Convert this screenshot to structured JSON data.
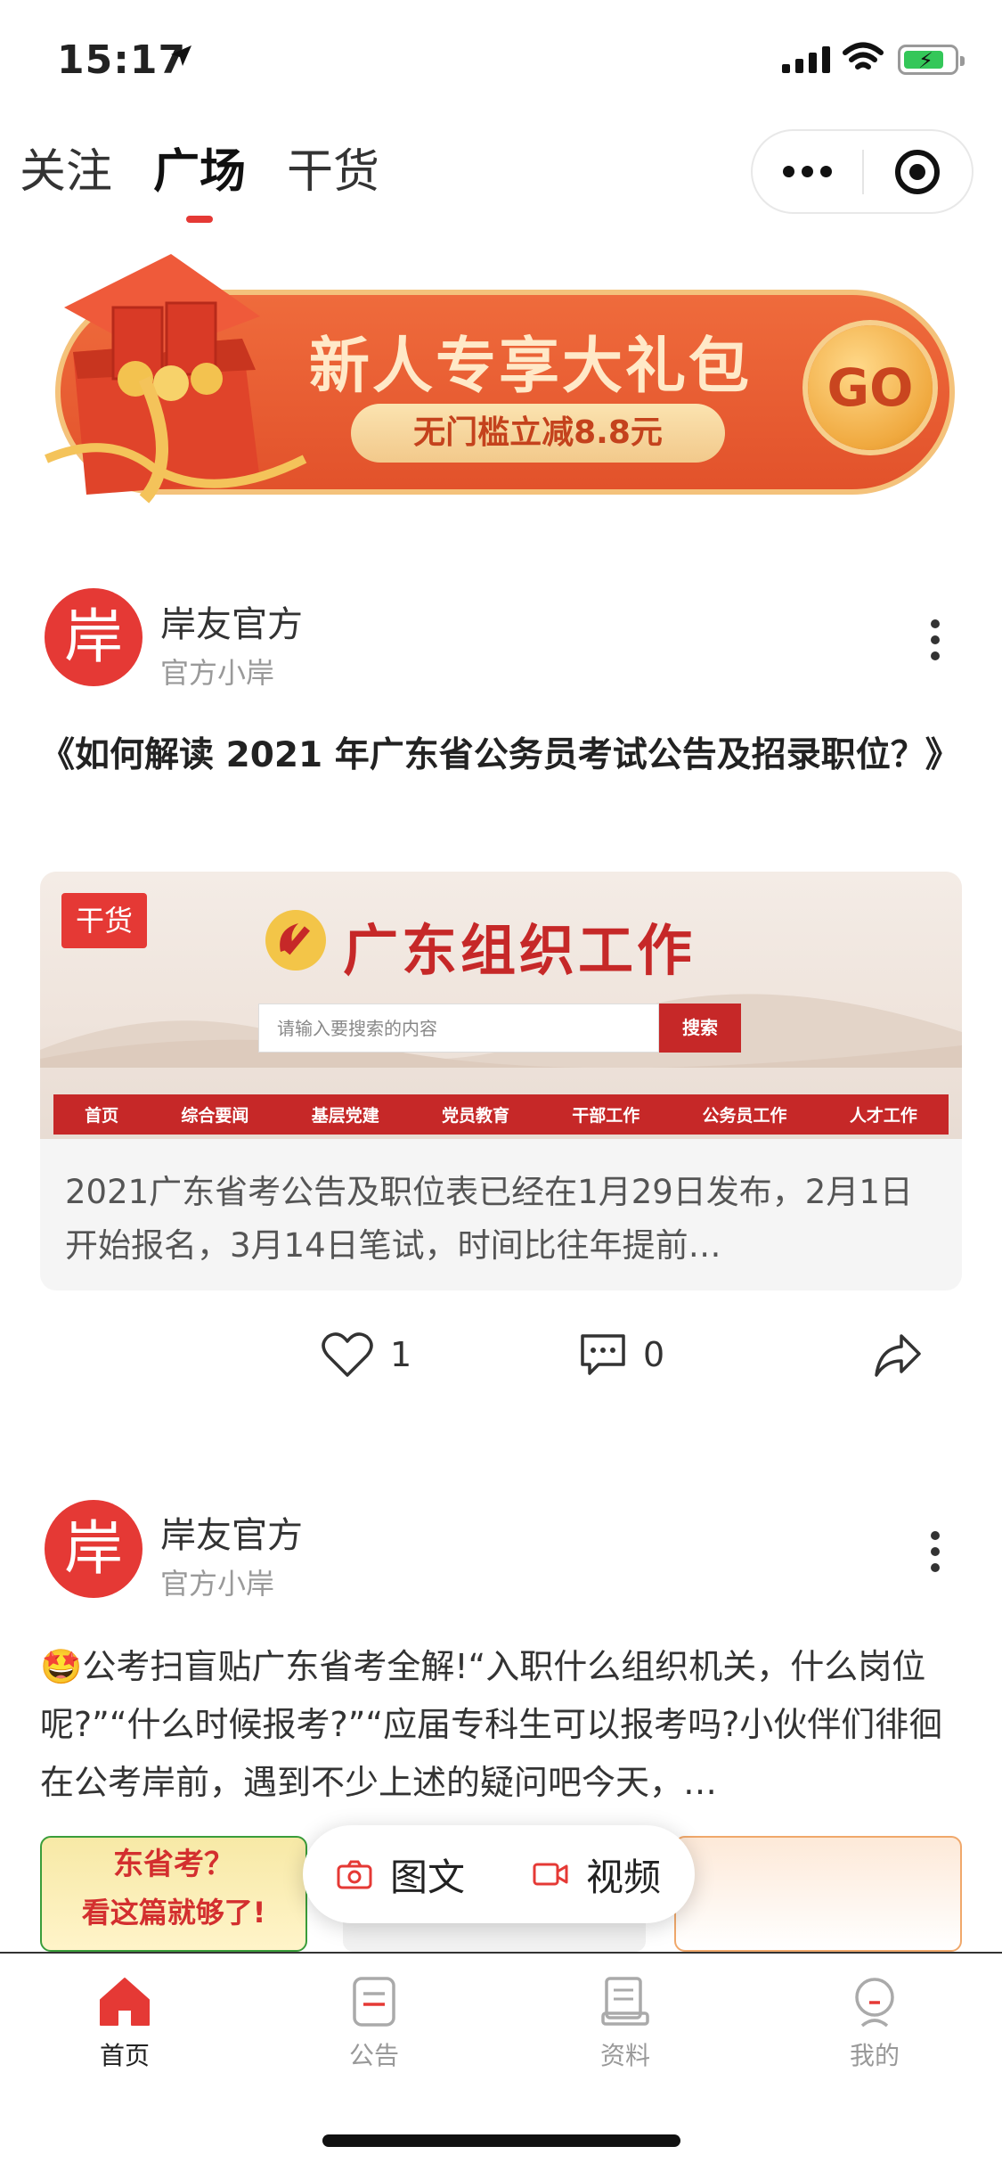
{
  "status_bar": {
    "time": "15:17"
  },
  "top_tabs": [
    {
      "label": "关注"
    },
    {
      "label": "广场",
      "active": true
    },
    {
      "label": "干货"
    }
  ],
  "banner": {
    "title": "新人专享大礼包",
    "subtitle": "无门槛立减8.8元",
    "go_label": "GO"
  },
  "posts": [
    {
      "avatar_char": "岸",
      "author": "岸友官方",
      "author_sub": "官方小岸",
      "title": "《如何解读 2021 年广东省公务员考试公告及招录职位？》",
      "card": {
        "tag": "干货",
        "site_title": "广东组织工作",
        "search_placeholder": "请输入要搜索的内容",
        "search_button": "搜索",
        "nav": [
          "首页",
          "综合要闻",
          "基层党建",
          "党员教育",
          "干部工作",
          "公务员工作",
          "人才工作"
        ],
        "description": "2021广东省考公告及职位表已经在1月29日发布，2月1日开始报名，3月14日笔试，时间比往年提前…"
      },
      "likes": "1",
      "comments": "0"
    },
    {
      "avatar_char": "岸",
      "author": "岸友官方",
      "author_sub": "官方小岸",
      "text": "🤩公考扫盲贴广东省考全解!“入职什么组织机关，什么岗位呢?”“什么时候报考?”“应届专科生可以报考吗?小伙伴们徘徊在公考岸前，遇到不少上述的疑问吧今天，…",
      "thumb_texts": [
        "东省考？",
        "看这篇就够了!"
      ]
    }
  ],
  "fab": {
    "image_text_label": "图文",
    "video_label": "视频"
  },
  "tabbar": [
    {
      "label": "首页",
      "active": true
    },
    {
      "label": "公告"
    },
    {
      "label": "资料"
    },
    {
      "label": "我的"
    }
  ],
  "colors": {
    "accent": "#e53935",
    "banner": "#e85d32"
  }
}
